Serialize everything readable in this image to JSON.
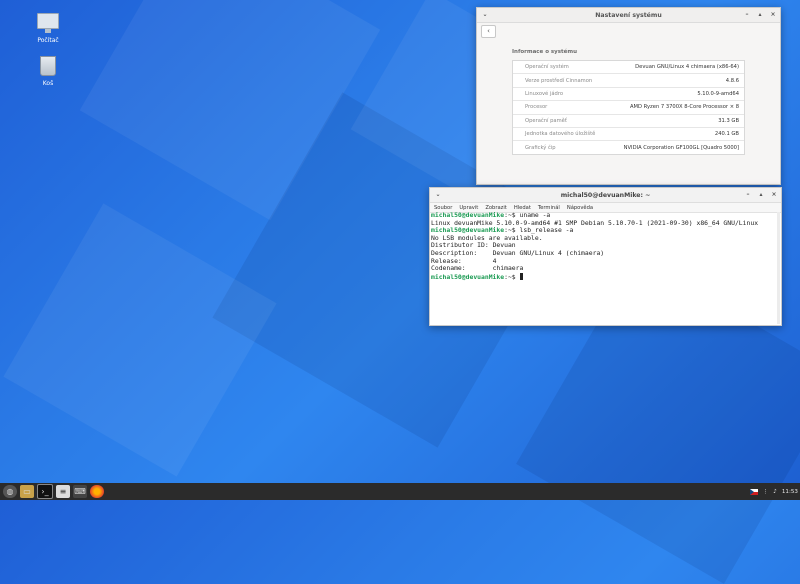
{
  "desktop": {
    "icons": [
      {
        "label": "Počítač",
        "icon": "computer-icon"
      },
      {
        "label": "Koš",
        "icon": "trash-icon"
      }
    ]
  },
  "settings": {
    "title": "Nastavení systému",
    "section_title": "Informace o systému",
    "rows": [
      {
        "label": "Operační systém",
        "value": "Devuan GNU/Linux 4 chimaera (x86-64)"
      },
      {
        "label": "Verze prostředí Cinnamon",
        "value": "4.8.6"
      },
      {
        "label": "Linuxové jádro",
        "value": "5.10.0-9-amd64"
      },
      {
        "label": "Procesor",
        "value": "AMD Ryzen 7 3700X 8-Core Processor × 8"
      },
      {
        "label": "Operační paměť",
        "value": "31.3 GB"
      },
      {
        "label": "Jednotka datového úložiště",
        "value": "240.1 GB"
      },
      {
        "label": "Grafický čip",
        "value": "NVIDIA Corporation GF100GL [Quadro 5000]"
      }
    ]
  },
  "terminal": {
    "title": "michal50@devuanMike: ~",
    "menu": [
      "Soubor",
      "Upravit",
      "Zobrazit",
      "Hledat",
      "Terminál",
      "Nápověda"
    ],
    "prompt": "michal50@devuanMike",
    "lines": [
      {
        "type": "cmd",
        "path": ":~$ ",
        "text": "uname -a"
      },
      {
        "type": "out",
        "text": "Linux devuanMike 5.10.0-9-amd64 #1 SMP Debian 5.10.70-1 (2021-09-30) x86_64 GNU/Linux"
      },
      {
        "type": "cmd",
        "path": ":~$ ",
        "text": "lsb_release -a"
      },
      {
        "type": "out",
        "text": "No LSB modules are available."
      },
      {
        "type": "out",
        "text": "Distributor ID:\tDevuan"
      },
      {
        "type": "out",
        "text": "Description:\tDevuan GNU/Linux 4 (chimaera)"
      },
      {
        "type": "out",
        "text": "Release:\t4"
      },
      {
        "type": "out",
        "text": "Codename:\tchimaera"
      },
      {
        "type": "cmd",
        "path": ":~$ ",
        "text": ""
      }
    ]
  },
  "taskbar": {
    "apps": [
      "menu-icon",
      "files-icon",
      "terminal-icon",
      "text-editor-icon",
      "keyboard-icon",
      "firefox-icon"
    ],
    "clock": "11:53"
  }
}
